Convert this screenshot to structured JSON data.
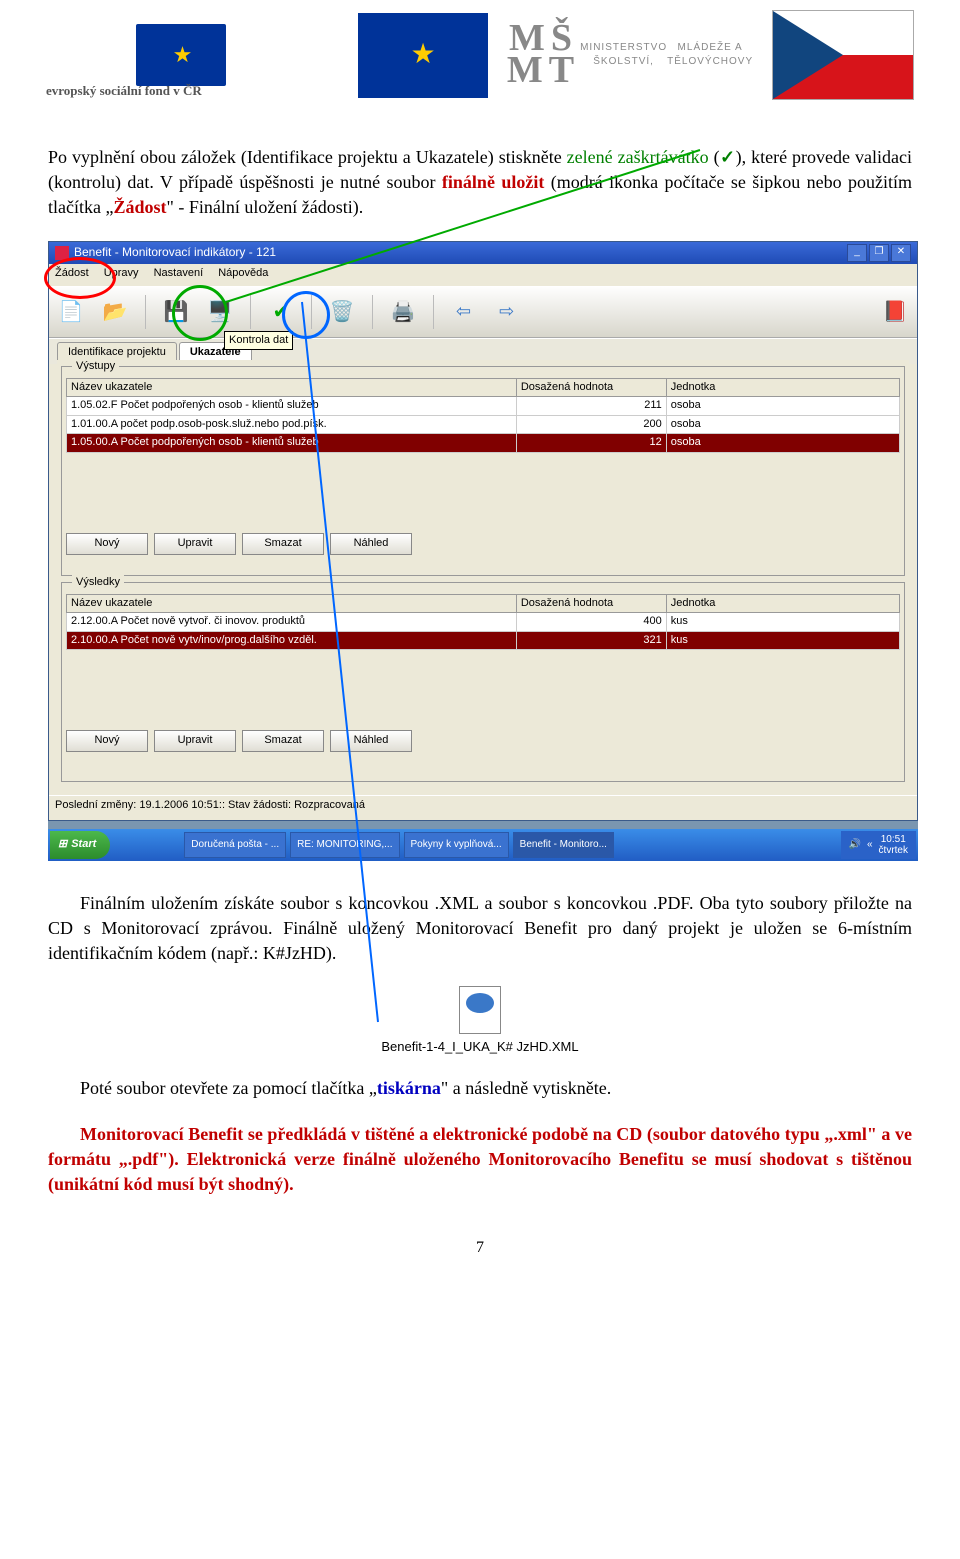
{
  "header": {
    "esf_text": "evropský sociální fond v ČR",
    "msmt_line1": "MŠ",
    "msmt_line2": "MT",
    "msmt_sub1": "MINISTERSTVO ŠKOLSTVÍ,",
    "msmt_sub2": "MLÁDEŽE A TĚLOVÝCHOVY"
  },
  "para1": {
    "t1": "Po vyplnění obou záložek (Identifikace projektu a Ukazatele) stiskněte ",
    "green1": "zelené zaškrtávátko",
    "t2": "(",
    "check": "✓",
    "t3": "), které provede validaci (kontrolu) dat. V případě úspěšnosti je nutné soubor ",
    "red1": "finálně uložit",
    "t4": " (modrá ikonka počítače se šipkou nebo použitím tlačítka „",
    "red2": "Žádost",
    "t5": "\" - Finální uložení žádosti)."
  },
  "screenshot": {
    "title": "Benefit - Monitorovací indikátory - 121",
    "menus": [
      "Žádost",
      "Úpravy",
      "Nastavení",
      "Nápověda"
    ],
    "tooltip": "Kontrola dat",
    "tabs": [
      "Identifikace projektu",
      "Ukazatele"
    ],
    "groups": {
      "vystupy": {
        "title": "Výstupy",
        "headers": [
          "Název ukazatele",
          "Dosažená hodnota",
          "Jednotka"
        ],
        "rows": [
          {
            "name": "1.05.02.F Počet podpořených osob - klientů služeb",
            "val": "211",
            "unit": "osoba",
            "sel": false
          },
          {
            "name": "1.01.00.A počet podp.osob-posk.služ.nebo pod.písk.",
            "val": "200",
            "unit": "osoba",
            "sel": false
          },
          {
            "name": "1.05.00.A Počet podpořených osob - klientů služeb",
            "val": "12",
            "unit": "osoba",
            "sel": true
          }
        ]
      },
      "vysledky": {
        "title": "Výsledky",
        "headers": [
          "Název ukazatele",
          "Dosažená hodnota",
          "Jednotka"
        ],
        "rows": [
          {
            "name": "2.12.00.A Počet nově vytvoř. či inovov. produktů",
            "val": "400",
            "unit": "kus",
            "sel": false
          },
          {
            "name": "2.10.00.A Počet nově vytv/inov/prog.dalšího vzděl.",
            "val": "321",
            "unit": "kus",
            "sel": true
          }
        ]
      }
    },
    "buttons": [
      "Nový",
      "Upravit",
      "Smazat",
      "Náhled"
    ],
    "status": "Poslední změny: 19.1.2006 10:51:: Stav žádosti: Rozpracovaná",
    "taskbar": {
      "start": "Start",
      "items": [
        "Doručená pošta - ...",
        "RE: MONITORING,...",
        "Pokyny k vyplňová...",
        "Benefit - Monitoro..."
      ],
      "clock": "10:51",
      "day": "čtvrtek"
    }
  },
  "para2": {
    "t1": "Finálním uložením získáte soubor s koncovkou .XML a soubor s koncovkou .PDF. Oba tyto soubory přiložte na CD s Monitorovací zprávou. Finálně uložený Monitorovací Benefit pro daný projekt je uložen se 6-místním identifikačním kódem (např.: K#JzHD)."
  },
  "file_label": "Benefit-1-4_I_UKA_K# JzHD.XML",
  "para3": {
    "t1": "Poté soubor otevřete za pomocí tlačítka „",
    "blue1": "tiskárna",
    "t2": "\" a následně vytiskněte."
  },
  "para4": {
    "t1": "Monitorovací Benefit se předkládá v tištěné a elektronické podobě na CD (soubor datového typu „.xml\" a ve formátu „.pdf\"). Elektronická verze finálně uloženého Monitorovacího Benefitu se musí shodovat s tištěnou (unikátní kód musí být shodný)."
  },
  "page_number": "7"
}
